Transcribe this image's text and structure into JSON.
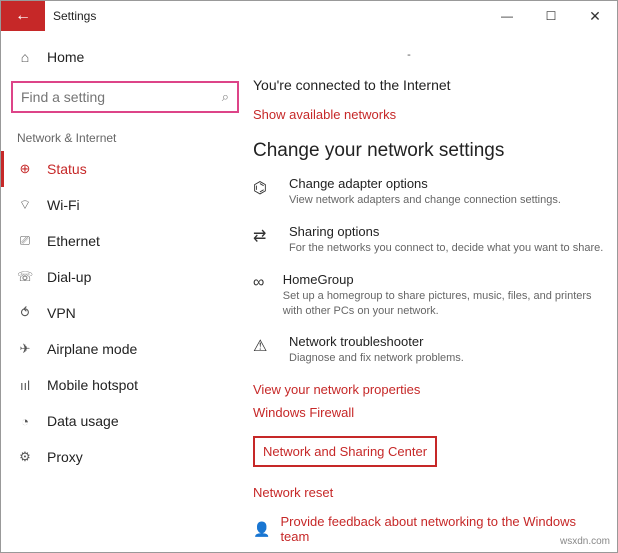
{
  "window": {
    "title": "Settings",
    "controls": {
      "min": "—",
      "max": "☐",
      "close": "✕"
    },
    "back_glyph": "←"
  },
  "sidebar": {
    "home_label": "Home",
    "home_icon": "⌂",
    "search_placeholder": "Find a setting",
    "search_icon": "⌕",
    "section_label": "Network & Internet",
    "items": [
      {
        "label": "Status",
        "icon": "⊕"
      },
      {
        "label": "Wi-Fi",
        "icon": "⌔"
      },
      {
        "label": "Ethernet",
        "icon": "⎚"
      },
      {
        "label": "Dial-up",
        "icon": "☏"
      },
      {
        "label": "VPN",
        "icon": "⥀"
      },
      {
        "label": "Airplane mode",
        "icon": "✈"
      },
      {
        "label": "Mobile hotspot",
        "icon": "ııl"
      },
      {
        "label": "Data usage",
        "icon": "◔"
      },
      {
        "label": "Proxy",
        "icon": "⚙"
      }
    ]
  },
  "main": {
    "connected_text": "You're connected to the Internet",
    "link_show_networks": "Show available networks",
    "heading_change": "Change your network settings",
    "options": [
      {
        "title": "Change adapter options",
        "desc": "View network adapters and change connection settings.",
        "icon": "⌬"
      },
      {
        "title": "Sharing options",
        "desc": "For the networks you connect to, decide what you want to share.",
        "icon": "⇄"
      },
      {
        "title": "HomeGroup",
        "desc": "Set up a homegroup to share pictures, music, files, and printers with other PCs on your network.",
        "icon": "∞"
      },
      {
        "title": "Network troubleshooter",
        "desc": "Diagnose and fix network problems.",
        "icon": "⚠"
      }
    ],
    "link_properties": "View your network properties",
    "link_firewall": "Windows Firewall",
    "link_sharing_center": "Network and Sharing Center",
    "link_reset": "Network reset",
    "feedback": "Provide feedback about networking to the Windows team",
    "feedback_icon": "👤"
  },
  "watermark": "wsxdn.com"
}
